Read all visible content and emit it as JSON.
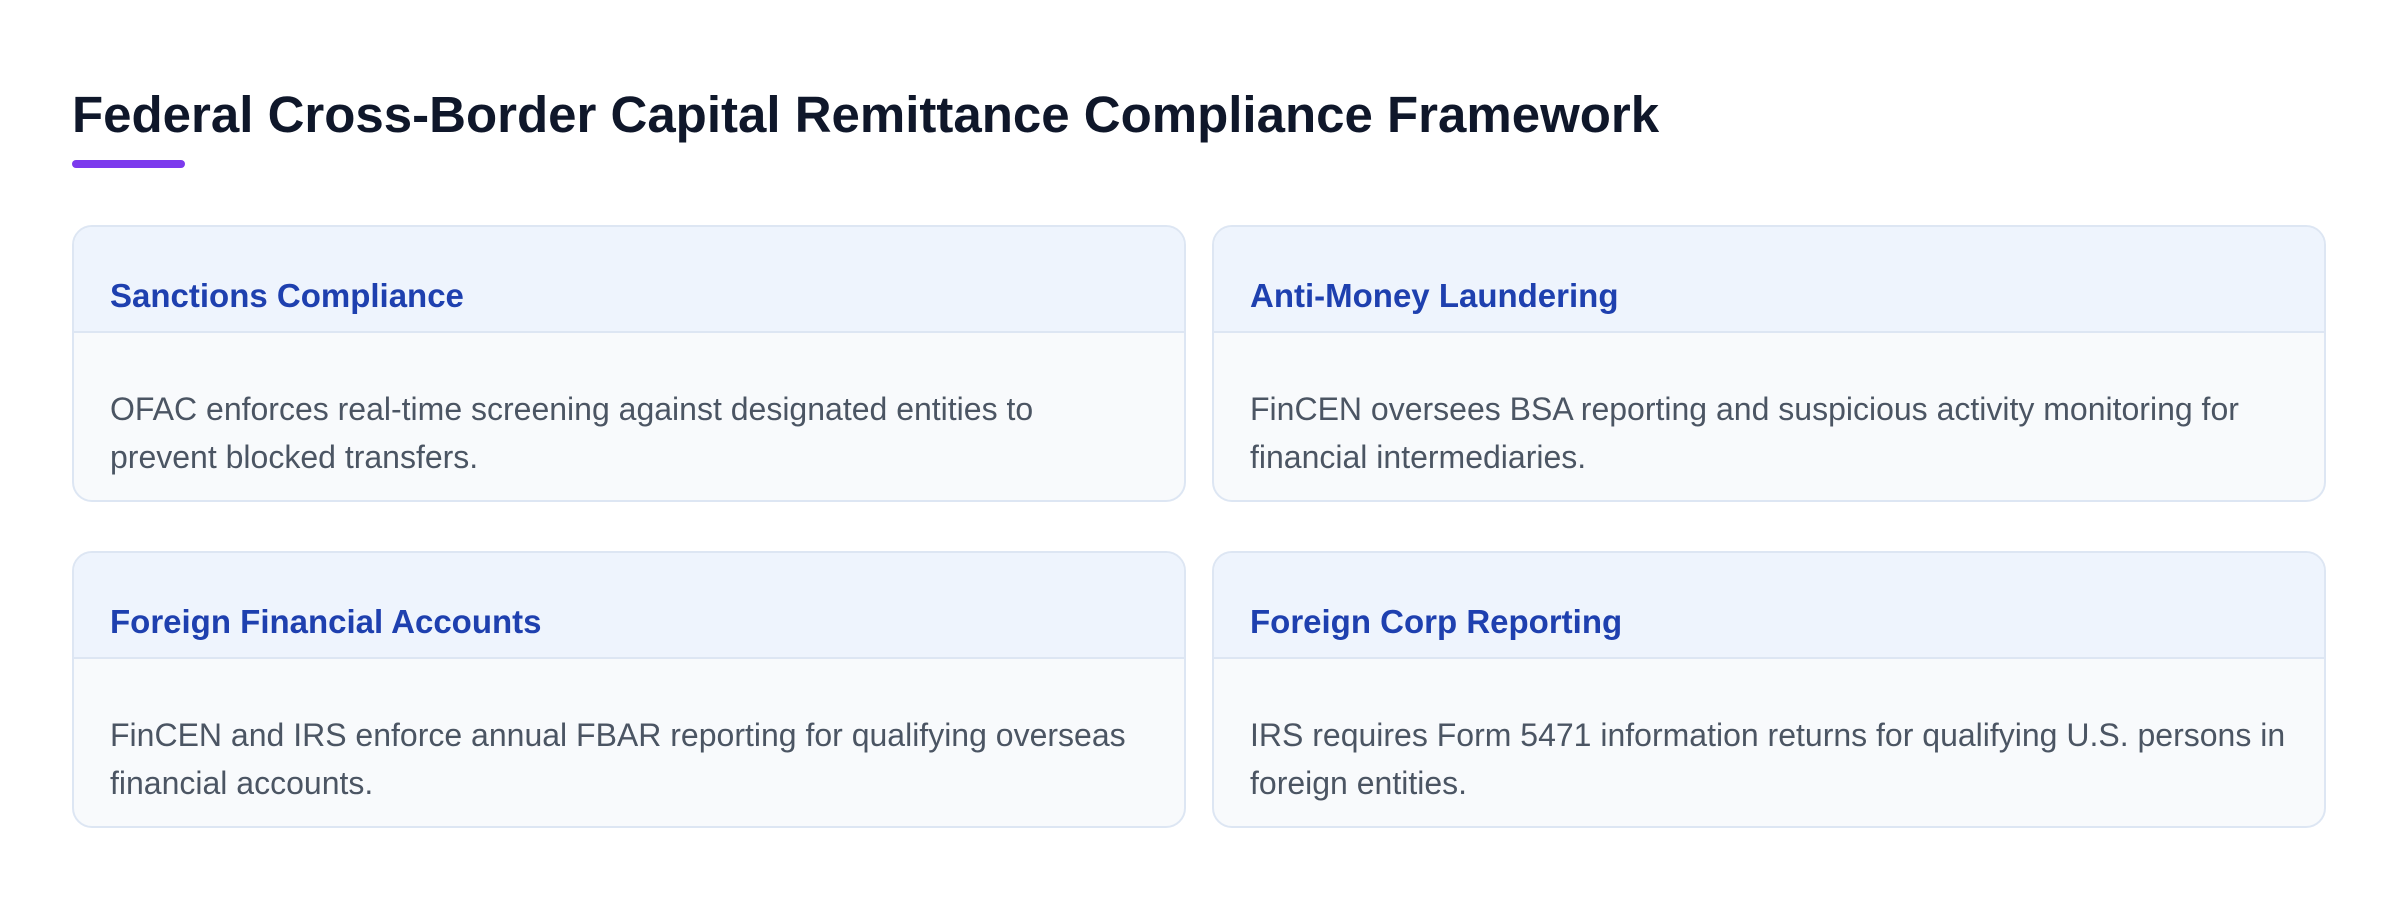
{
  "page": {
    "title": "Federal Cross-Border Capital Remittance Compliance Framework"
  },
  "colors": {
    "title_text": "#0f172a",
    "accent_underline": "#7c3aed",
    "card_title": "#1e40af",
    "card_text": "#4b5563",
    "card_header_bg": "#eef4fd",
    "card_body_bg": "#f8fafc",
    "card_border": "#dde6f3"
  },
  "cards": [
    {
      "title": "Sanctions Compliance",
      "text": "OFAC enforces real-time screening against designated entities to prevent blocked transfers."
    },
    {
      "title": "Anti-Money Laundering",
      "text": "FinCEN oversees BSA reporting and suspicious activity monitoring for financial intermediaries."
    },
    {
      "title": "Foreign Financial Accounts",
      "text": "FinCEN and IRS enforce annual FBAR reporting for qualifying overseas financial accounts."
    },
    {
      "title": "Foreign Corp Reporting",
      "text": "IRS requires Form 5471 information returns for qualifying U.S. persons in foreign entities."
    }
  ]
}
